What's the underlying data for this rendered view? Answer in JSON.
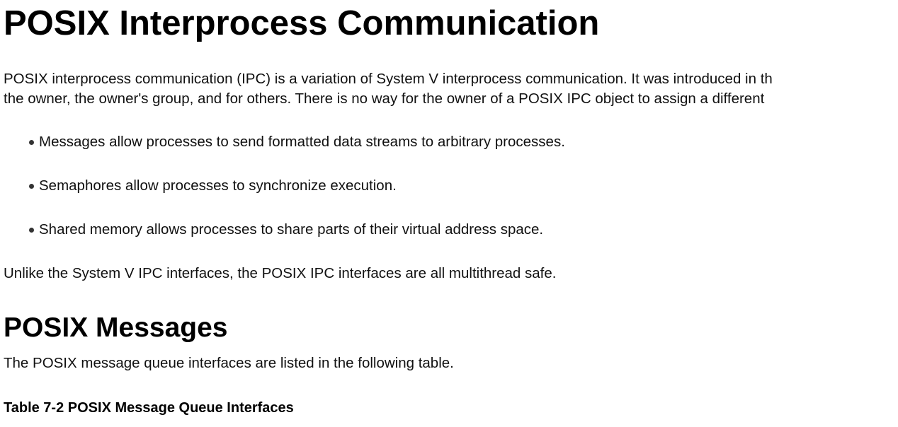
{
  "document": {
    "title": "POSIX Interprocess Communication",
    "intro_lines": [
      "POSIX interprocess communication (IPC) is a variation of System V interprocess communication. It was introduced in th",
      "the owner, the owner's group, and for others. There is no way for the owner of a POSIX IPC object to assign a different"
    ],
    "bullets": [
      "Messages allow processes to send formatted data streams to arbitrary processes.",
      "Semaphores allow processes to synchronize execution.",
      "Shared memory allows processes to share parts of their virtual address space."
    ],
    "unlike_paragraph": "Unlike the System V IPC interfaces, the POSIX IPC interfaces are all multithread safe.",
    "messages_section": {
      "heading": "POSIX Messages",
      "paragraph": "The POSIX message queue interfaces are listed in the following table.",
      "table_caption": "Table 7-2 POSIX Message Queue Interfaces"
    }
  }
}
